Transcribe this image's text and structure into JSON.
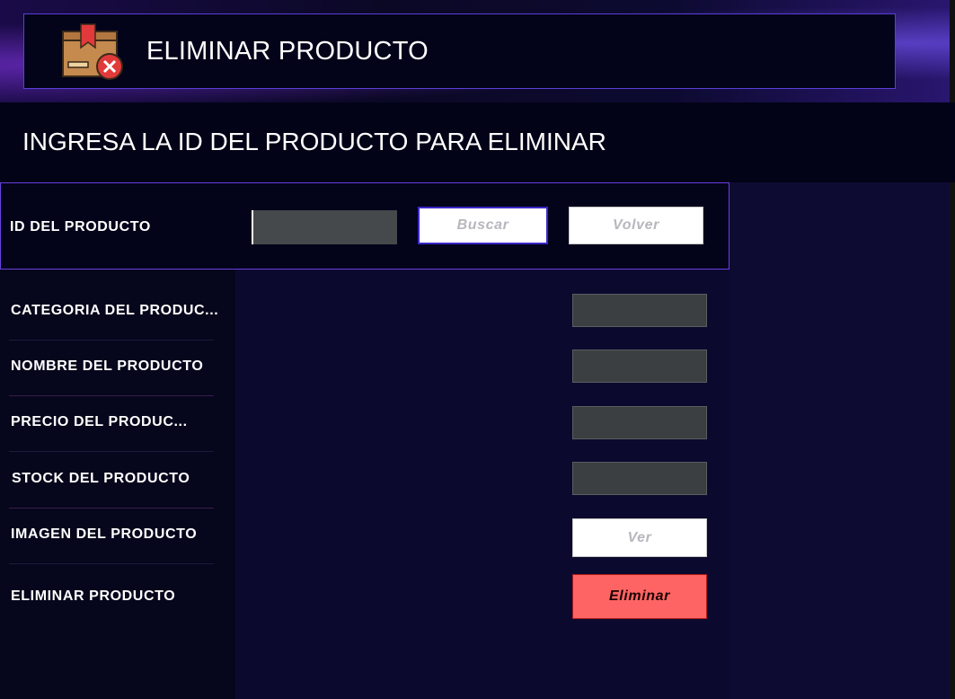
{
  "header": {
    "title": "ELIMINAR PRODUCTO",
    "icon": "box-delete-icon"
  },
  "subheader": "INGRESA LA ID DEL PRODUCTO PARA ELIMINAR",
  "search": {
    "label": "ID DEL PRODUCTO",
    "id_value": "",
    "buscar_label": "Buscar",
    "volver_label": "Volver"
  },
  "form": {
    "categoria_label": "CATEGORIA DEL PRODUC...",
    "nombre_label": "NOMBRE DEL PRODUCTO",
    "precio_label": "PRECIO DEL PRODUC...",
    "stock_label": "STOCK DEL PRODUCTO",
    "imagen_label": "IMAGEN DEL PRODUCTO",
    "eliminar_label": "ELIMINAR PRODUCTO",
    "categoria_value": "",
    "nombre_value": "",
    "precio_value": "",
    "stock_value": "",
    "ver_label": "Ver",
    "eliminar_button_label": "Eliminar"
  },
  "colors": {
    "accent_border": "#6a3fe0",
    "danger_button": "#ff6464",
    "input_bg": "#3c3f41"
  }
}
